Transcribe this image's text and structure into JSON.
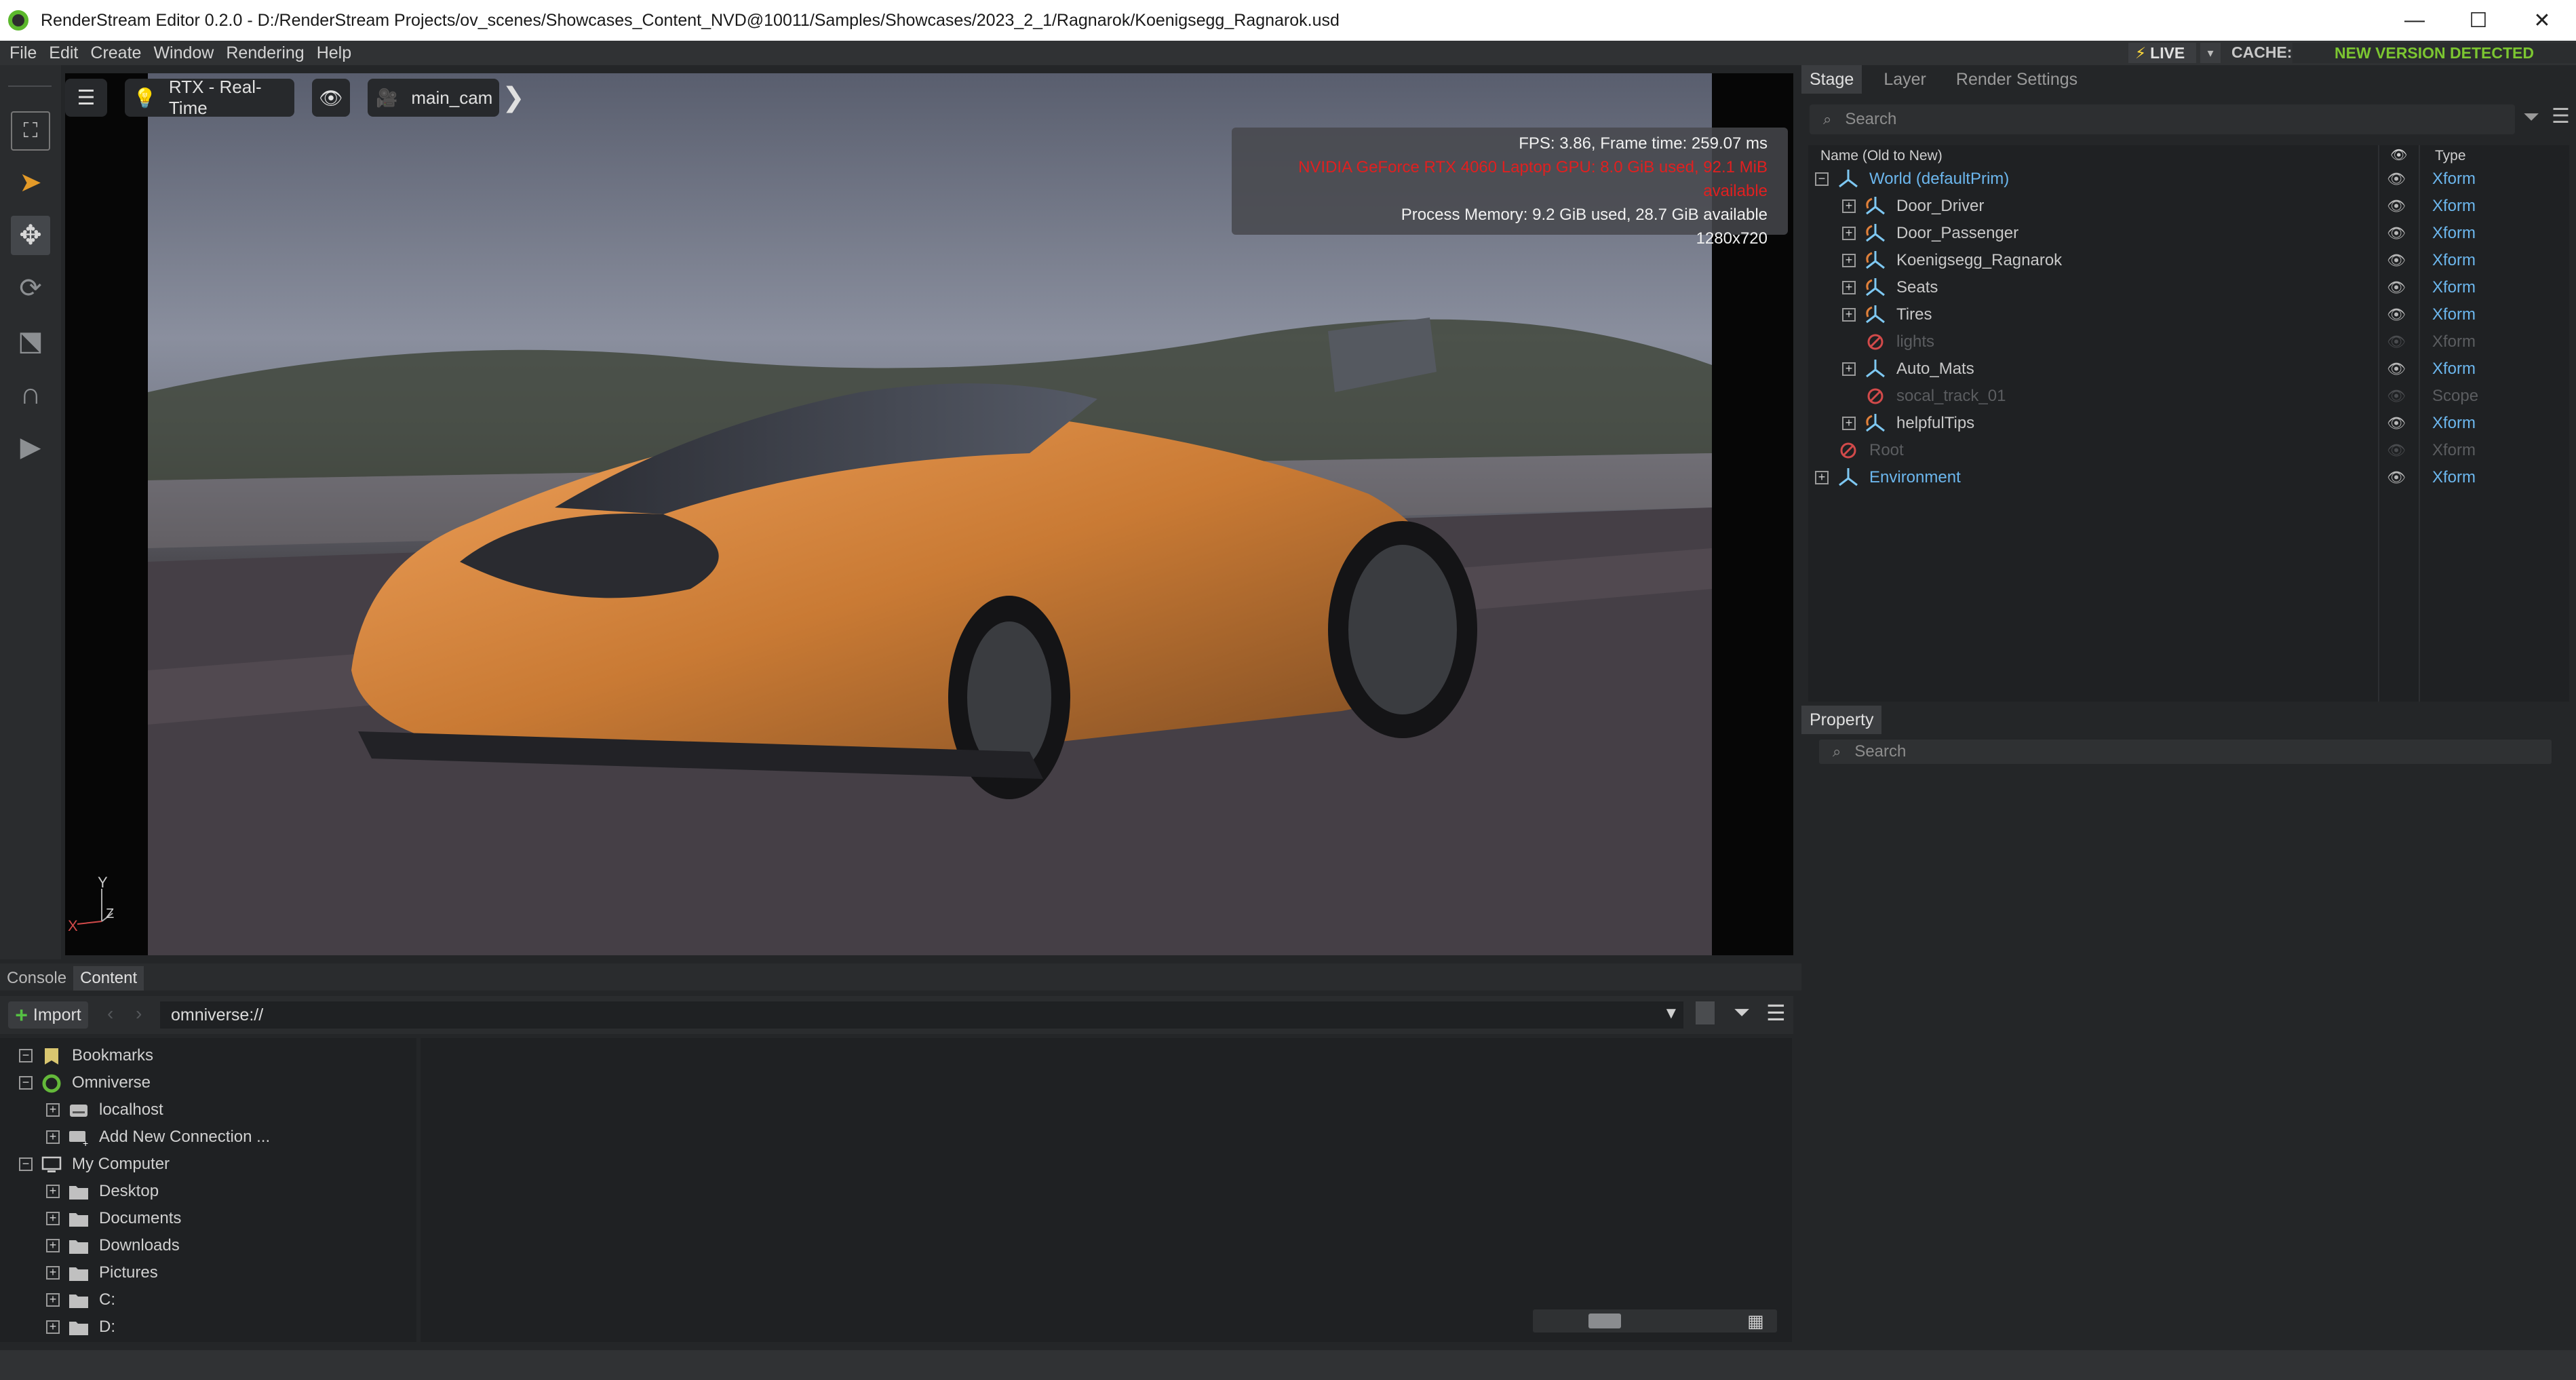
{
  "window": {
    "title": "RenderStream Editor 0.2.0 - D:/RenderStream Projects/ov_scenes/Showcases_Content_NVD@10011/Samples/Showcases/2023_2_1/Ragnarok/Koenigsegg_Ragnarok.usd",
    "minimize": "—",
    "maximize": "☐",
    "close": "✕"
  },
  "menu": [
    "File",
    "Edit",
    "Create",
    "Window",
    "Rendering",
    "Help"
  ],
  "status": {
    "live": "LIVE",
    "cache_label": "CACHE:",
    "version_notice": "NEW VERSION DETECTED"
  },
  "viewport": {
    "renderer": "RTX - Real-Time",
    "camera": "main_cam",
    "stats": {
      "fps": "FPS: 3.86, Frame time: 259.07 ms",
      "gpu": "NVIDIA GeForce RTX 4060 Laptop GPU: 8.0 GiB used, 92.1 MiB available",
      "memory": "Process Memory: 9.2 GiB used, 28.7 GiB available",
      "resolution": "1280x720"
    },
    "axis": {
      "y": "Y",
      "x": "X",
      "z": "Z"
    }
  },
  "bottom_tabs": [
    "Console",
    "Content"
  ],
  "content": {
    "import_label": "Import",
    "path": "omniverse://",
    "tree": [
      {
        "label": "Bookmarks",
        "icon": "bookmark-icon",
        "indent": 0,
        "expander": "−"
      },
      {
        "label": "Omniverse",
        "icon": "omniverse-icon",
        "indent": 0,
        "expander": "−"
      },
      {
        "label": "localhost",
        "icon": "server-icon",
        "indent": 1,
        "expander": "+"
      },
      {
        "label": "Add New Connection ...",
        "icon": "add-connection-icon",
        "indent": 1,
        "expander": "+"
      },
      {
        "label": "My Computer",
        "icon": "computer-icon",
        "indent": 0,
        "expander": "−"
      },
      {
        "label": "Desktop",
        "icon": "folder-icon",
        "indent": 1,
        "expander": "+"
      },
      {
        "label": "Documents",
        "icon": "folder-icon",
        "indent": 1,
        "expander": "+"
      },
      {
        "label": "Downloads",
        "icon": "folder-icon",
        "indent": 1,
        "expander": "+"
      },
      {
        "label": "Pictures",
        "icon": "folder-icon",
        "indent": 1,
        "expander": "+"
      },
      {
        "label": "C:",
        "icon": "folder-icon",
        "indent": 1,
        "expander": "+"
      },
      {
        "label": "D:",
        "icon": "folder-icon",
        "indent": 1,
        "expander": "+"
      }
    ]
  },
  "stage": {
    "tabs": [
      "Stage",
      "Layer",
      "Render Settings"
    ],
    "search_placeholder": "Search",
    "columns": {
      "name": "Name (Old to New)",
      "type": "Type"
    },
    "rows": [
      {
        "name": "World (defaultPrim)",
        "type": "Xform",
        "indent": 0,
        "expander": "−",
        "icon": "xform-icon",
        "active": true
      },
      {
        "name": "Door_Driver",
        "type": "Xform",
        "indent": 1,
        "expander": "+",
        "icon": "xform-ref-icon",
        "active": true
      },
      {
        "name": "Door_Passenger",
        "type": "Xform",
        "indent": 1,
        "expander": "+",
        "icon": "xform-ref-icon",
        "active": true
      },
      {
        "name": "Koenigsegg_Ragnarok",
        "type": "Xform",
        "indent": 1,
        "expander": "+",
        "icon": "xform-ref-icon",
        "active": true
      },
      {
        "name": "Seats",
        "type": "Xform",
        "indent": 1,
        "expander": "+",
        "icon": "xform-ref-icon",
        "active": true
      },
      {
        "name": "Tires",
        "type": "Xform",
        "indent": 1,
        "expander": "+",
        "icon": "xform-ref-icon",
        "active": true
      },
      {
        "name": "lights",
        "type": "Xform",
        "indent": 1,
        "expander": "",
        "icon": "disabled-icon",
        "active": false
      },
      {
        "name": "Auto_Mats",
        "type": "Xform",
        "indent": 1,
        "expander": "+",
        "icon": "xform-icon",
        "active": true
      },
      {
        "name": "socal_track_01",
        "type": "Scope",
        "indent": 1,
        "expander": "",
        "icon": "disabled-icon",
        "active": false
      },
      {
        "name": "helpfulTips",
        "type": "Xform",
        "indent": 1,
        "expander": "+",
        "icon": "xform-ref-icon",
        "active": true
      },
      {
        "name": "Root",
        "type": "Xform",
        "indent": 0,
        "expander": "",
        "icon": "disabled-icon",
        "active": false
      },
      {
        "name": "Environment",
        "type": "Xform",
        "indent": 0,
        "expander": "+",
        "icon": "xform-icon",
        "active": true
      }
    ]
  },
  "property": {
    "tab": "Property",
    "search_placeholder": "Search"
  },
  "colors": {
    "accent_green": "#7cc631",
    "type_blue": "#6cb7ee",
    "gpu_red": "#e02020",
    "live_bolt": "#ffd93b"
  }
}
